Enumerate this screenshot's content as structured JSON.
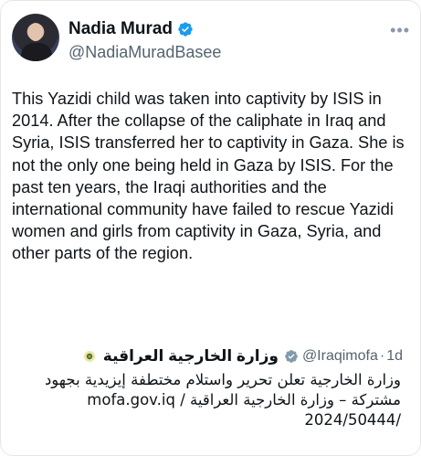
{
  "author": {
    "name": "Nadia Murad",
    "handle": "@NadiaMuradBasee"
  },
  "tweet": {
    "text": "This Yazidi child was taken into captivity by ISIS in 2014. After the collapse of the caliphate in Iraq and Syria, ISIS transferred her to captivity in Gaza. She is not the only one being held in Gaza by ISIS. For the past ten years, the Iraqi authorities and the international community have failed to rescue Yazidi women and girls from captivity in Gaza, Syria, and other parts of the region."
  },
  "quote": {
    "name": "وزارة الخارجية العراقية",
    "handle": "@Iraqimofa",
    "separator": "·",
    "time": "1d",
    "lines": [
      "وزارة الخارجية تعلن تحرير واستلام مختطفة إيزيدية بجهود",
      "مشتركة – وزارة الخارجية العراقية / mofa.gov.iq",
      "/2024/50444"
    ]
  },
  "colors": {
    "verified_blue": "#1d9bf0",
    "verified_gray": "#829aab",
    "secondary_text": "#536471"
  },
  "icons": [
    "verified-badge-icon",
    "more-options-icon",
    "ministry-logo-icon"
  ]
}
